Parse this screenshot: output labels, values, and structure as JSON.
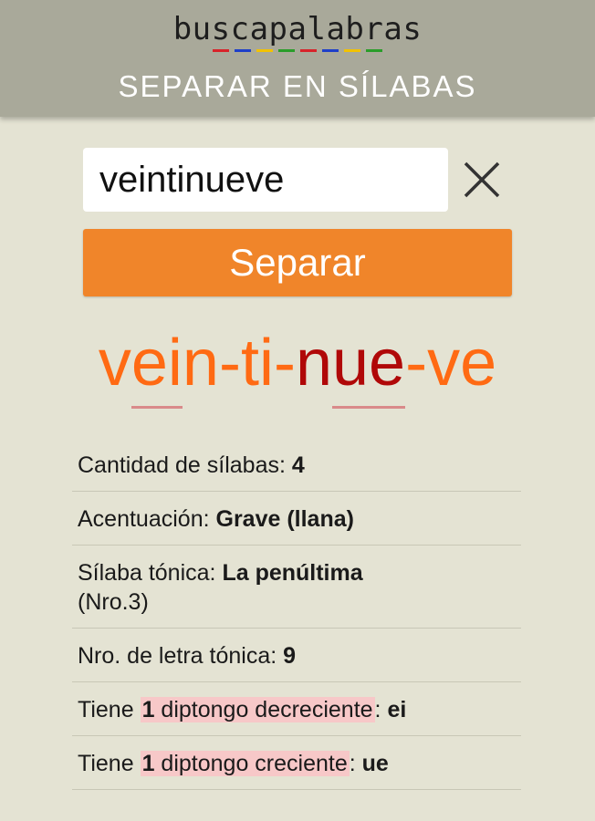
{
  "header": {
    "logo_text": "buscapalabras",
    "logo_stripe_colors": [
      "#d8232a",
      "#1e3fc9",
      "#f2c200",
      "#2a9d2a",
      "#d8232a",
      "#1e3fc9",
      "#f2c200",
      "#2a9d2a"
    ],
    "subtitle": "SEPARAR EN SÍLABAS"
  },
  "search": {
    "value": "veintinueve",
    "placeholder": "",
    "clear_icon": "close-icon"
  },
  "button": {
    "label": "Separar"
  },
  "result": {
    "syllables": [
      {
        "text": "vein",
        "color": "#ff6a13",
        "underline": "ei"
      },
      {
        "text": "-",
        "color": "#ff6a13"
      },
      {
        "text": "ti",
        "color": "#ff6a13"
      },
      {
        "text": "-",
        "color": "#ff6a13"
      },
      {
        "text": "nue",
        "color": "#b00808",
        "underline": "ue"
      },
      {
        "text": "-",
        "color": "#ff6a13"
      },
      {
        "text": "ve",
        "color": "#ff6a13"
      }
    ]
  },
  "info": {
    "silabas_label": "Cantidad de sílabas:",
    "silabas_value": "4",
    "acentuacion_label": "Acentuación:",
    "acentuacion_value": "Grave (llana)",
    "tonica_label": "Sílaba tónica:",
    "tonica_value": "La penúltima",
    "tonica_note": "(Nro.3)",
    "letra_label": "Nro. de letra tónica:",
    "letra_value": "9",
    "diptongo1_prefix": "Tiene",
    "diptongo1_count": "1",
    "diptongo1_text": "diptongo decreciente",
    "diptongo1_value": "ei",
    "diptongo2_prefix": "Tiene",
    "diptongo2_count": "1",
    "diptongo2_text": "diptongo creciente",
    "diptongo2_value": "ue"
  }
}
